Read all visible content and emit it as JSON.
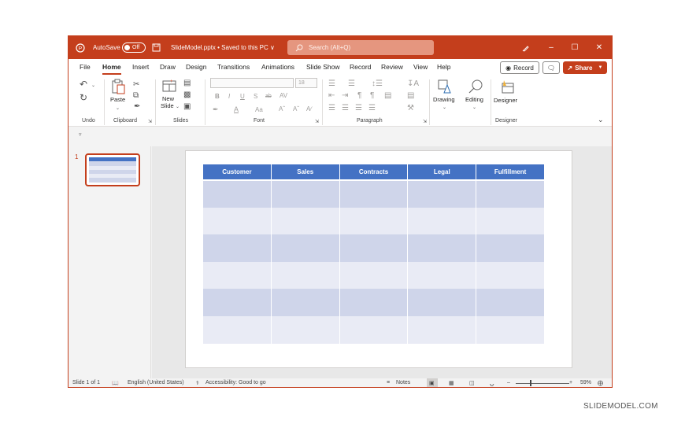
{
  "titlebar": {
    "autosave_label": "AutoSave",
    "autosave_state": "Off",
    "document_title": "SlideModel.pptx • Saved to this PC ∨",
    "search_placeholder": "Search (Alt+Q)"
  },
  "menu": {
    "tabs": [
      "File",
      "Home",
      "Insert",
      "Draw",
      "Design",
      "Transitions",
      "Animations",
      "Slide Show",
      "Record",
      "Review",
      "View",
      "Help"
    ],
    "active_tab": "Home",
    "record_label": "Record",
    "share_label": "Share"
  },
  "ribbon": {
    "groups": {
      "undo": "Undo",
      "clipboard": "Clipboard",
      "slides": "Slides",
      "font": "Font",
      "paragraph": "Paragraph",
      "designer": "Designer"
    },
    "paste_label": "Paste",
    "new_slide_label_1": "New",
    "new_slide_label_2": "Slide",
    "font_size": "18",
    "drawing_label": "Drawing",
    "editing_label": "Editing",
    "designer_label": "Designer"
  },
  "slides_pane": {
    "slide_number": "1"
  },
  "slide": {
    "table": {
      "headers": [
        "Customer",
        "Sales",
        "Contracts",
        "Legal",
        "Fulfillment"
      ],
      "rows": [
        [
          "",
          "",
          "",
          "",
          ""
        ],
        [
          "",
          "",
          "",
          "",
          ""
        ],
        [
          "",
          "",
          "",
          "",
          ""
        ],
        [
          "",
          "",
          "",
          "",
          ""
        ],
        [
          "",
          "",
          "",
          "",
          ""
        ],
        [
          "",
          "",
          "",
          "",
          ""
        ]
      ]
    }
  },
  "statusbar": {
    "slide_count": "Slide 1 of 1",
    "language": "English (United States)",
    "accessibility": "Accessibility: Good to go",
    "notes_label": "Notes",
    "zoom_level": "59%",
    "zoom_fraction": 0.59
  },
  "colors": {
    "accent": "#c43e1c",
    "table_header": "#4472c4",
    "table_band_dark": "#cfd5ea",
    "table_band_light": "#e9ebf5"
  },
  "footer_brand": "SLIDEMODEL.COM"
}
